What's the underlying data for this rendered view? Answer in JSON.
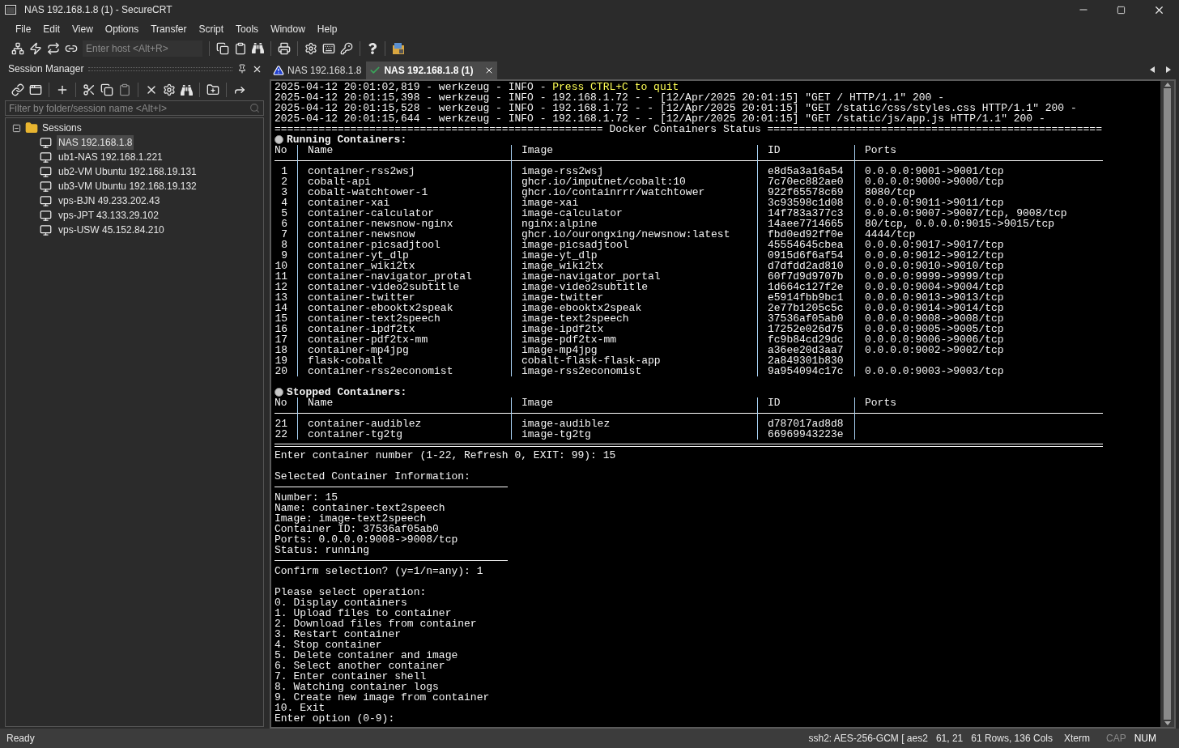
{
  "window": {
    "title": "NAS 192.168.1.8 (1) - SecureCRT"
  },
  "menu": [
    "File",
    "Edit",
    "View",
    "Options",
    "Transfer",
    "Script",
    "Tools",
    "Window",
    "Help"
  ],
  "toolbar": {
    "host_placeholder": "Enter host <Alt+R>"
  },
  "session_manager": {
    "title": "Session Manager",
    "filter_placeholder": "Filter by folder/session name <Alt+I>",
    "tree": [
      {
        "label": "Sessions",
        "expanded": true,
        "children": [
          {
            "label": "NAS 192.168.1.8",
            "selected": true
          },
          {
            "label": "ub1-NAS 192.168.1.221",
            "selected": false
          },
          {
            "label": "ub2-VM Ubuntu 192.168.19.131",
            "selected": false
          },
          {
            "label": "ub3-VM Ubuntu 192.168.19.132",
            "selected": false
          },
          {
            "label": "vps-BJN 49.233.202.43",
            "selected": false
          },
          {
            "label": "vps-JPT 43.133.29.102",
            "selected": false
          },
          {
            "label": "vps-USW 45.152.84.210",
            "selected": false
          }
        ]
      }
    ]
  },
  "tabs": [
    {
      "label": "NAS 192.168.1.8",
      "selected": false,
      "kind": "warning"
    },
    {
      "label": "NAS 192.168.1.8 (1)",
      "selected": true,
      "kind": "connected"
    }
  ],
  "terminal": {
    "log_lines": [
      {
        "prefix": "2025-04-12 20:01:02,819 - werkzeug - INFO - ",
        "message": "Press CTRL+C to quit",
        "highlight": true
      },
      {
        "prefix": "2025-04-12 20:01:15,398 - werkzeug - INFO - ",
        "message": "192.168.1.72 - - [12/Apr/2025 20:01:15] \"GET / HTTP/1.1\" 200 -",
        "highlight": false
      },
      {
        "prefix": "2025-04-12 20:01:15,528 - werkzeug - INFO - ",
        "message": "192.168.1.72 - - [12/Apr/2025 20:01:15] \"GET /static/css/styles.css HTTP/1.1\" 200 -",
        "highlight": false
      },
      {
        "prefix": "2025-04-12 20:01:15,644 - werkzeug - INFO - ",
        "message": "192.168.1.72 - - [12/Apr/2025 20:01:15] \"GET /static/js/app.js HTTP/1.1\" 200 -",
        "highlight": false
      }
    ],
    "banner": "==================================================== Docker Containers Status =====================================================",
    "sections": [
      {
        "title": "Running Containers:",
        "columns": [
          "No",
          "Name",
          "Image",
          "ID",
          "Ports"
        ],
        "rows": [
          {
            "no": "1",
            "name": "container-rss2wsj",
            "image": "image-rss2wsj",
            "id": "e8d5a3a16a54",
            "ports": "0.0.0.0:9001->9001/tcp"
          },
          {
            "no": "2",
            "name": "cobalt-api",
            "image": "ghcr.io/imputnet/cobalt:10",
            "id": "7c70ec882ae0",
            "ports": "0.0.0.0:9000->9000/tcp"
          },
          {
            "no": "3",
            "name": "cobalt-watchtower-1",
            "image": "ghcr.io/containrrr/watchtower",
            "id": "922f65578c69",
            "ports": "8080/tcp"
          },
          {
            "no": "4",
            "name": "container-xai",
            "image": "image-xai",
            "id": "3c93598c1d08",
            "ports": "0.0.0.0:9011->9011/tcp"
          },
          {
            "no": "5",
            "name": "container-calculator",
            "image": "image-calculator",
            "id": "14f783a377c3",
            "ports": "0.0.0.0:9007->9007/tcp, 9008/tcp"
          },
          {
            "no": "6",
            "name": "container-newsnow-nginx",
            "image": "nginx:alpine",
            "id": "14aee7714665",
            "ports": "80/tcp, 0.0.0.0:9015->9015/tcp"
          },
          {
            "no": "7",
            "name": "container-newsnow",
            "image": "ghcr.io/ourongxing/newsnow:latest",
            "id": "fbd0ed92ff0e",
            "ports": "4444/tcp"
          },
          {
            "no": "8",
            "name": "container-picsadjtool",
            "image": "image-picsadjtool",
            "id": "45554645cbea",
            "ports": "0.0.0.0:9017->9017/tcp"
          },
          {
            "no": "9",
            "name": "container-yt_dlp",
            "image": "image-yt_dlp",
            "id": "0915d6f6af54",
            "ports": "0.0.0.0:9012->9012/tcp"
          },
          {
            "no": "10",
            "name": "container_wiki2tx",
            "image": "image_wiki2tx",
            "id": "d7dfdd2ad810",
            "ports": "0.0.0.0:9010->9010/tcp"
          },
          {
            "no": "11",
            "name": "container-navigator_protal",
            "image": "image-navigator_portal",
            "id": "60f7d9d9707b",
            "ports": "0.0.0.0:9999->9999/tcp"
          },
          {
            "no": "12",
            "name": "container-video2subtitle",
            "image": "image-video2subtitle",
            "id": "1d664c127f2e",
            "ports": "0.0.0.0:9004->9004/tcp"
          },
          {
            "no": "13",
            "name": "container-twitter",
            "image": "image-twitter",
            "id": "e5914fbb9bc1",
            "ports": "0.0.0.0:9013->9013/tcp"
          },
          {
            "no": "14",
            "name": "container-ebooktx2speak",
            "image": "image-ebooktx2speak",
            "id": "2e77b1205c5c",
            "ports": "0.0.0.0:9014->9014/tcp"
          },
          {
            "no": "15",
            "name": "container-text2speech",
            "image": "image-text2speech",
            "id": "37536af05ab0",
            "ports": "0.0.0.0:9008->9008/tcp"
          },
          {
            "no": "16",
            "name": "container-ipdf2tx",
            "image": "image-ipdf2tx",
            "id": "17252e026d75",
            "ports": "0.0.0.0:9005->9005/tcp"
          },
          {
            "no": "17",
            "name": "container-pdf2tx-mm",
            "image": "image-pdf2tx-mm",
            "id": "fc9b84cd29dc",
            "ports": "0.0.0.0:9006->9006/tcp"
          },
          {
            "no": "18",
            "name": "container-mp4jpg",
            "image": "image-mp4jpg",
            "id": "a36ee20d3aa7",
            "ports": "0.0.0.0:9002->9002/tcp"
          },
          {
            "no": "19",
            "name": "flask-cobalt",
            "image": "cobalt-flask-flask-app",
            "id": "2a849301b830"
          },
          {
            "no": "20",
            "name": "container-rss2economist",
            "image": "image-rss2economist",
            "id": "9a954094c17c",
            "ports": "0.0.0.0:9003->9003/tcp"
          }
        ]
      },
      {
        "title": "Stopped Containers:",
        "columns": [
          "No",
          "Name",
          "Image",
          "ID",
          "Ports"
        ],
        "rows": [
          {
            "no": "21",
            "name": "container-audiblez",
            "image": "image-audiblez",
            "id": "d787017ad8d8"
          },
          {
            "no": "22",
            "name": "container-tg2tg",
            "image": "image-tg2tg",
            "id": "66969943223e"
          }
        ]
      }
    ],
    "after_lines": [
      {
        "kind": "text",
        "text": "Enter container number (1-22, Refresh 0, EXIT: 99): 15"
      },
      {
        "kind": "blank"
      },
      {
        "kind": "text",
        "text": "Selected Container Information:"
      },
      {
        "kind": "rule"
      },
      {
        "kind": "text",
        "text": "Number: 15"
      },
      {
        "kind": "text",
        "text": "Name: container-text2speech"
      },
      {
        "kind": "text",
        "text": "Image: image-text2speech"
      },
      {
        "kind": "text",
        "text": "Container ID: 37536af05ab0"
      },
      {
        "kind": "text",
        "text": "Ports: 0.0.0.0:9008->9008/tcp"
      },
      {
        "kind": "text",
        "text": "Status: running"
      },
      {
        "kind": "rule"
      },
      {
        "kind": "text",
        "text": "Confirm selection? (y=1/n=any): 1"
      },
      {
        "kind": "blank"
      },
      {
        "kind": "text",
        "text": "Please select operation:"
      },
      {
        "kind": "text",
        "text": "0. Display containers"
      },
      {
        "kind": "text",
        "text": "1. Upload files to container"
      },
      {
        "kind": "text",
        "text": "2. Download files from container"
      },
      {
        "kind": "text",
        "text": "3. Restart container"
      },
      {
        "kind": "text",
        "text": "4. Stop container"
      },
      {
        "kind": "text",
        "text": "5. Delete container and image"
      },
      {
        "kind": "text",
        "text": "6. Select another container"
      },
      {
        "kind": "text",
        "text": "7. Enter container shell"
      },
      {
        "kind": "text",
        "text": "8. Watching container logs"
      },
      {
        "kind": "text",
        "text": "9. Create new image from container"
      },
      {
        "kind": "text",
        "text": "10. Exit"
      },
      {
        "kind": "text",
        "text": "Enter option (0-9):"
      }
    ]
  },
  "status_bar": {
    "message": "Ready",
    "cipher": "ssh2: AES-256-GCM [ aes2",
    "cursor": "61, 21",
    "size": "61 Rows, 136 Cols",
    "emulation": "Xterm",
    "indicators": [
      {
        "label": "CAP",
        "on": false
      },
      {
        "label": "NUM",
        "on": true
      }
    ]
  }
}
